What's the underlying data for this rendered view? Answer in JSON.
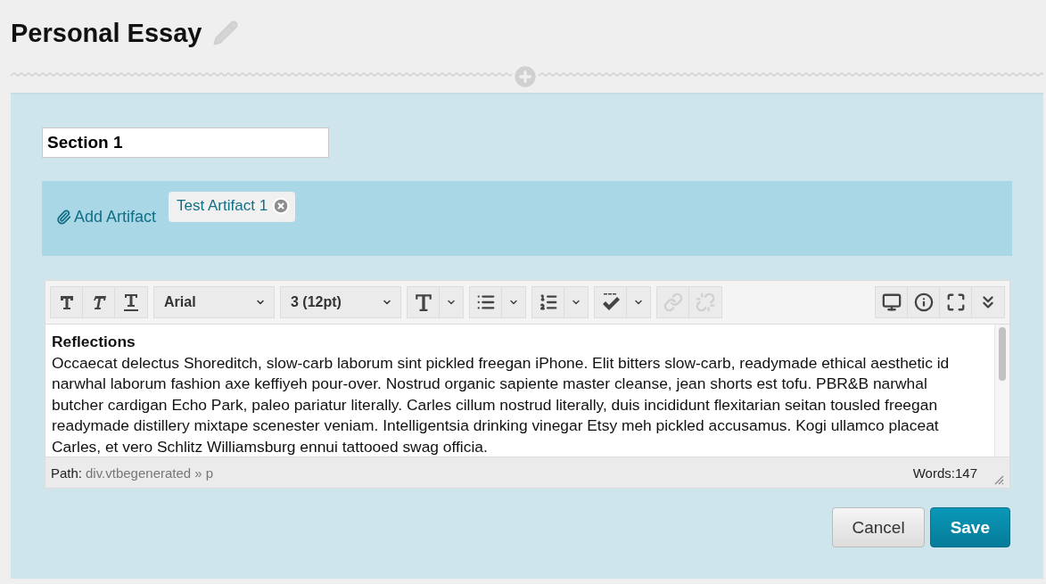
{
  "page": {
    "title": "Personal Essay"
  },
  "section": {
    "value": "Section 1"
  },
  "artifacts": {
    "add_label": "Add Artifact",
    "items": [
      {
        "label": "Test Artifact 1"
      }
    ]
  },
  "editor": {
    "toolbar_left": [
      {
        "tools": [
          {
            "kind": "bold",
            "disabled": false
          },
          {
            "kind": "italic",
            "disabled": false
          },
          {
            "kind": "underline",
            "disabled": false
          }
        ]
      },
      {
        "tools": [
          {
            "kind": "select",
            "label": "Arial",
            "disabled": false
          }
        ]
      },
      {
        "tools": [
          {
            "kind": "select",
            "label": "3 (12pt)",
            "disabled": false
          }
        ]
      },
      {
        "tools": [
          {
            "kind": "color",
            "disabled": false
          }
        ]
      },
      {
        "tools": [
          {
            "kind": "bullets",
            "disabled": false
          }
        ]
      },
      {
        "tools": [
          {
            "kind": "numbers",
            "disabled": false
          }
        ]
      },
      {
        "tools": [
          {
            "kind": "spell",
            "disabled": false
          }
        ]
      },
      {
        "tools": [
          {
            "kind": "link",
            "disabled": true
          },
          {
            "kind": "unlink",
            "disabled": true
          }
        ]
      }
    ],
    "toolbar_right": [
      {
        "tools": [
          {
            "kind": "preview",
            "disabled": false
          },
          {
            "kind": "info",
            "disabled": false
          },
          {
            "kind": "fullscreen",
            "disabled": false
          },
          {
            "kind": "more",
            "disabled": false
          }
        ]
      }
    ],
    "heading": "Reflections",
    "body": "Occaecat delectus Shoreditch, slow-carb laborum sint pickled freegan iPhone. Elit bitters slow-carb, readymade ethical aesthetic id narwhal laborum fashion axe keffiyeh pour-over. Nostrud organic sapiente master cleanse, jean shorts est tofu. PBR&B narwhal butcher cardigan Echo Park, paleo pariatur literally. Carles cillum nostrud literally, duis incididunt flexitarian seitan tousled freegan readymade distillery mixtape scenester veniam. Intelligentsia drinking vinegar Etsy meh pickled accusamus. Kogi ullamco placeat Carles, et vero Schlitz Williamsburg ennui tattooed swag officia.",
    "path_label": "Path:",
    "path": "div.vtbegenerated » p",
    "words": "Words:147"
  },
  "buttons": [
    {
      "kind": "secondary",
      "label": "Cancel"
    },
    {
      "kind": "primary",
      "label": "Save"
    }
  ]
}
